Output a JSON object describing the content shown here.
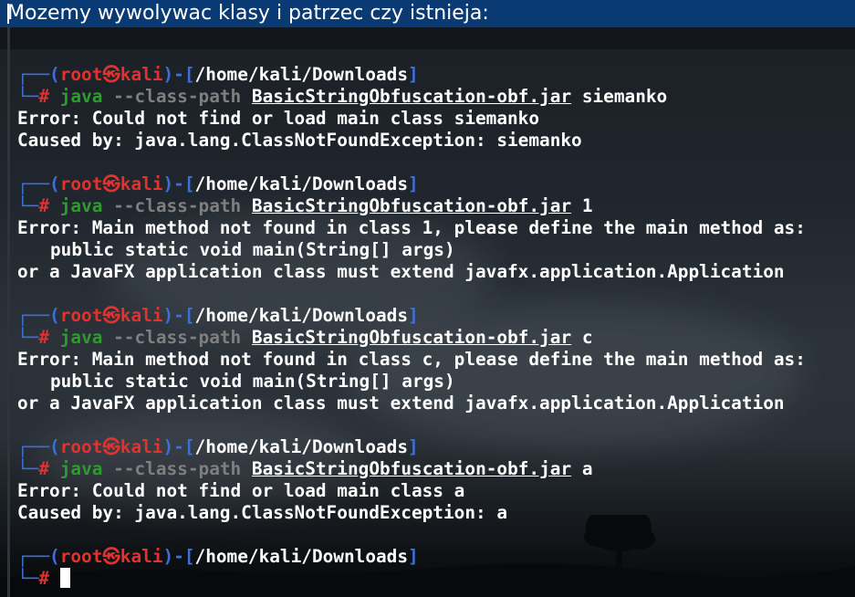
{
  "header": {
    "title": "Mozemy wywolywac klasy i patrzec czy istnieja:"
  },
  "prompt": {
    "box_top_left": "┌──(",
    "user": "root",
    "skull": "㉿",
    "host": "kali",
    "mid": ")-[",
    "path": "/home/kali/Downloads",
    "close": "]",
    "box_bottom": "└─",
    "hash": "#"
  },
  "blocks": [
    {
      "cmd": "java",
      "opt": "--class-path",
      "jar": "BasicStringObfuscation-obf.jar",
      "arg": "siemanko",
      "output": [
        "Error: Could not find or load main class siemanko",
        "Caused by: java.lang.ClassNotFoundException: siemanko"
      ]
    },
    {
      "cmd": "java",
      "opt": "--class-path",
      "jar": "BasicStringObfuscation-obf.jar",
      "arg": "1",
      "output": [
        "Error: Main method not found in class 1, please define the main method as:",
        "public static void main(String[] args)",
        "or a JavaFX application class must extend javafx.application.Application"
      ]
    },
    {
      "cmd": "java",
      "opt": "--class-path",
      "jar": "BasicStringObfuscation-obf.jar",
      "arg": "c",
      "output": [
        "Error: Main method not found in class c, please define the main method as:",
        "public static void main(String[] args)",
        "or a JavaFX application class must extend javafx.application.Application"
      ]
    },
    {
      "cmd": "java",
      "opt": "--class-path",
      "jar": "BasicStringObfuscation-obf.jar",
      "arg": "a",
      "output": [
        "Error: Could not find or load main class a",
        "Caused by: java.lang.ClassNotFoundException: a"
      ]
    }
  ],
  "colors": {
    "header_bg": "#0a3a73",
    "prompt_blue": "#3d6fd8",
    "prompt_red": "#e0322f",
    "command_green": "#2c9c2c",
    "option_grey": "#7f7f7f"
  }
}
